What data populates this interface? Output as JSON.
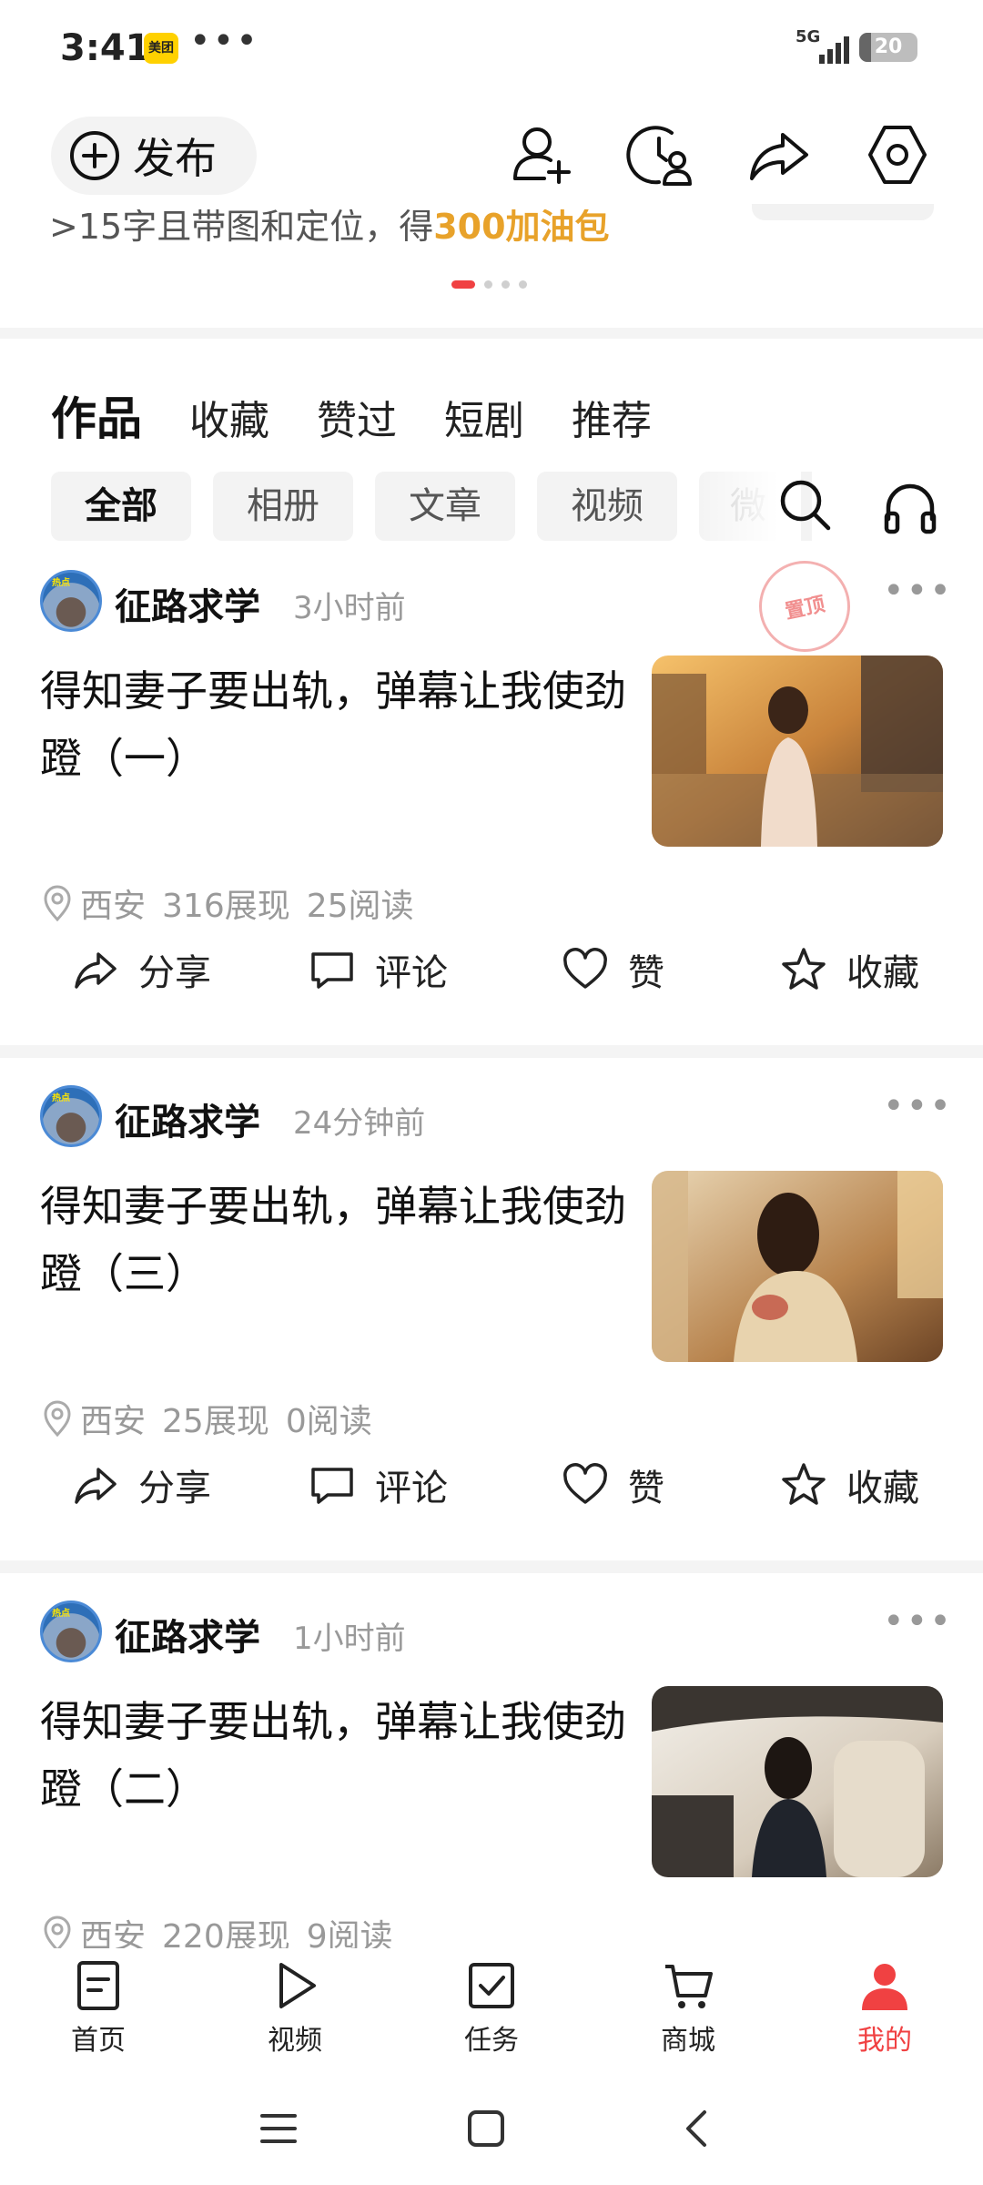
{
  "status_bar": {
    "time": "3:41",
    "app_badge": "美团",
    "more": "•••",
    "network": "5G",
    "battery": "20",
    "battery_level": 0.2
  },
  "header": {
    "publish_label": "发布",
    "icons": [
      "add-user-icon",
      "history-icon",
      "share-icon",
      "settings-icon"
    ]
  },
  "promo": {
    "text": ">15字且带图和定位，得",
    "highlight": "300加油包",
    "pager_total": 4,
    "pager_active": 1
  },
  "tabs": [
    "作品",
    "收藏",
    "赞过",
    "短剧",
    "推荐"
  ],
  "filters": [
    "全部",
    "相册",
    "文章",
    "视频",
    "微"
  ],
  "posts": [
    {
      "author": "征路求学",
      "time": "3小时前",
      "title": "得知妻子要出轨，弹幕让我使劲蹬（一）",
      "pinned": "置顶",
      "location": "西安",
      "impressions": "316展现",
      "reads": "25阅读"
    },
    {
      "author": "征路求学",
      "time": "24分钟前",
      "title": "得知妻子要出轨，弹幕让我使劲蹬（三）",
      "location": "西安",
      "impressions": "25展现",
      "reads": "0阅读"
    },
    {
      "author": "征路求学",
      "time": "1小时前",
      "title": "得知妻子要出轨，弹幕让我使劲蹬（二）",
      "location": "西安",
      "impressions": "220展现",
      "reads": "9阅读"
    }
  ],
  "actions": [
    "分享",
    "评论",
    "赞",
    "收藏"
  ],
  "bottom_nav": [
    {
      "label": "首页",
      "icon": "home-icon"
    },
    {
      "label": "视频",
      "icon": "video-play-icon"
    },
    {
      "label": "任务",
      "icon": "task-check-icon"
    },
    {
      "label": "商城",
      "icon": "cart-icon"
    },
    {
      "label": "我的",
      "icon": "profile-icon",
      "active": true
    }
  ],
  "colors": {
    "accent": "#f04142",
    "promo_highlight": "#e8a22a",
    "muted_text": "#999999"
  }
}
